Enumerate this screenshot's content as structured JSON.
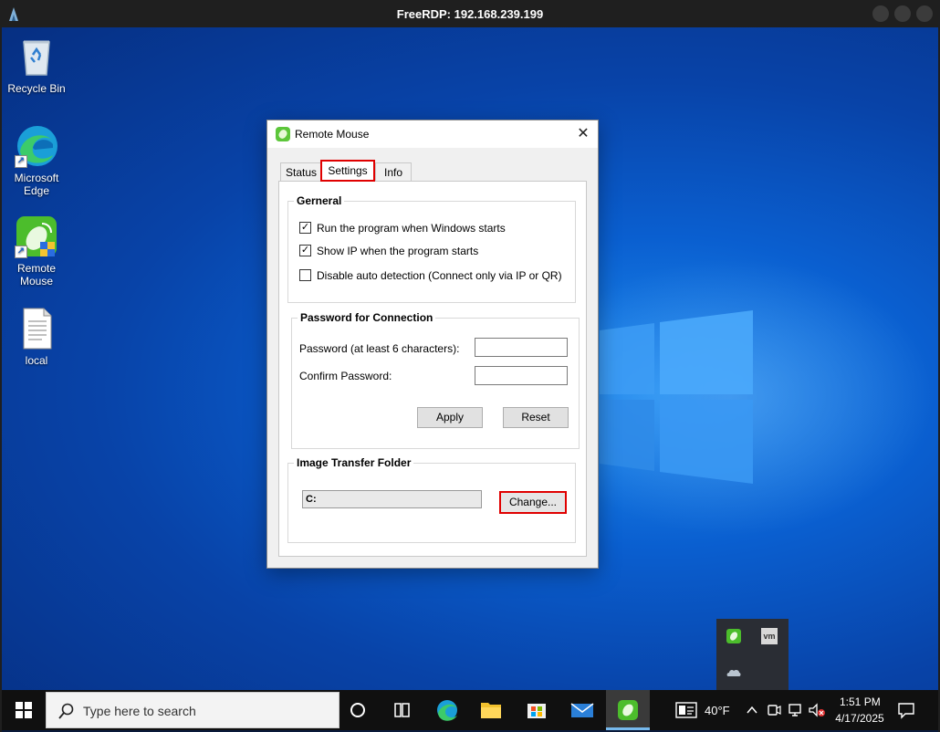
{
  "rdp": {
    "title": "FreeRDP: 192.168.239.199",
    "min_glyph": "",
    "max_glyph": "",
    "close_glyph": ""
  },
  "desktop_icons": [
    {
      "label": "Recycle Bin"
    },
    {
      "label": "Microsoft Edge"
    },
    {
      "label": "Remote Mouse"
    },
    {
      "label": "local"
    }
  ],
  "dialog": {
    "title": "Remote Mouse",
    "close_glyph": "✕",
    "tabs": {
      "status": "Status",
      "settings": "Settings",
      "info": "Info",
      "selected": "Settings"
    },
    "general": {
      "legend": "Gerneral",
      "options": [
        {
          "label": "Run the program when Windows starts",
          "checked": true,
          "mark": "✓"
        },
        {
          "label": "Show IP when the program starts",
          "checked": true,
          "mark": "✓"
        },
        {
          "label": "Disable auto detection (Connect only via IP or QR)",
          "checked": false,
          "mark": ""
        }
      ]
    },
    "password": {
      "legend": "Password for Connection",
      "password_label": "Password (at least 6 characters):",
      "password_value": "",
      "confirm_label": "Confirm Password:",
      "confirm_value": "",
      "apply_label": "Apply",
      "reset_label": "Reset"
    },
    "image_folder": {
      "legend": "Image Transfer Folder",
      "path": "C:",
      "change_label": "Change..."
    }
  },
  "taskbar": {
    "search_placeholder": "Type here to search",
    "weather": "40°F",
    "time": "1:51 PM",
    "date": "4/17/2025"
  },
  "tray_popup": {
    "vm_label": "vm"
  },
  "colors": {
    "highlight": "#e00000",
    "desktop_blue": "#0a5fd0",
    "taskbar": "#101010"
  }
}
